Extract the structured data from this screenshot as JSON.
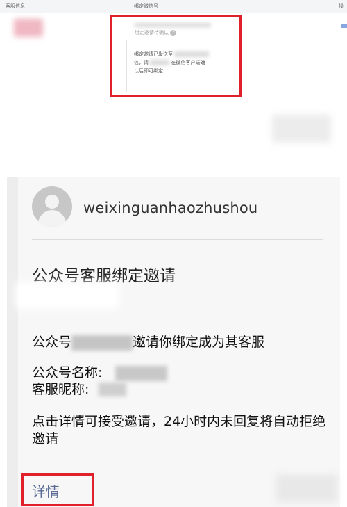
{
  "table": {
    "headers": [
      "客服信息",
      "绑定微信号",
      "操"
    ]
  },
  "popup": {
    "title": "绑定邀请待确认",
    "help_icon": "question-icon",
    "message_lines": [
      "绑定邀请已发送至",
      "信，请",
      "在微信客户端确",
      "认后即可绑定"
    ]
  },
  "card": {
    "account_name": "weixinguanhaozhushou",
    "title": "公众号客服绑定邀请",
    "invite_prefix": "公众号",
    "invite_suffix": "邀请你绑定成为其客服",
    "name_label": "公众号名称:",
    "nickname_label": "客服昵称:",
    "notice": "点击详情可接受邀请，24小时内未回复将自动拒绝邀请",
    "detail_link": "详情"
  },
  "colors": {
    "highlight": "#e0202a",
    "link": "#576b95"
  }
}
